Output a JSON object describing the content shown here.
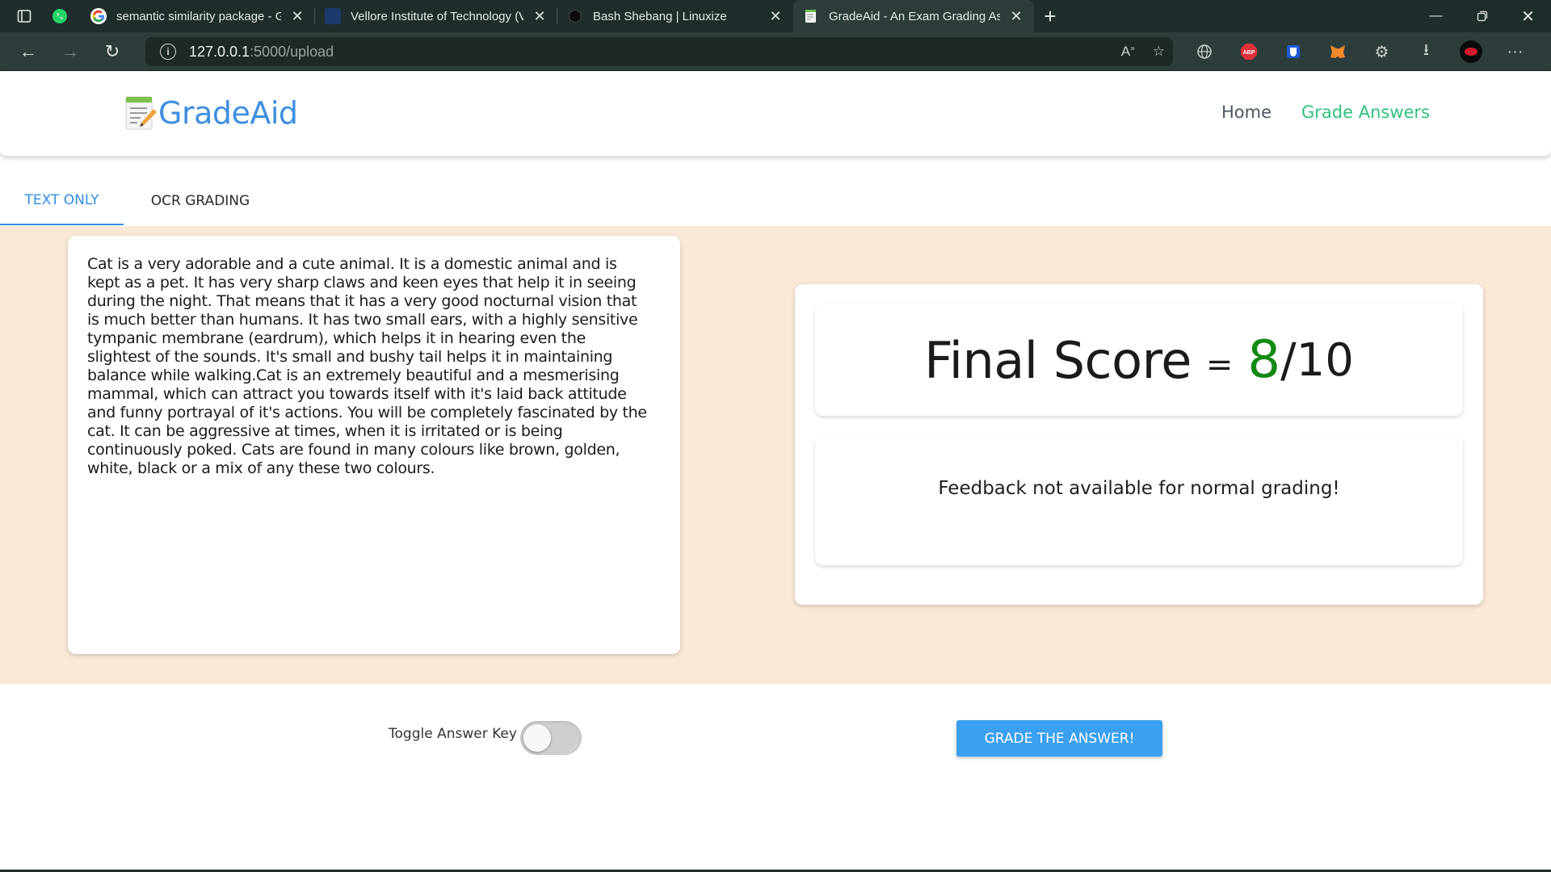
{
  "browser": {
    "tabs": [
      {
        "title": "semantic similarity package - Go",
        "favicon": "google-icon"
      },
      {
        "title": "Vellore Institute of Technology (V",
        "favicon": "vit-icon"
      },
      {
        "title": "Bash Shebang | Linuxize",
        "favicon": "linuxize-icon"
      },
      {
        "title": "GradeAid - An Exam Grading Ass",
        "favicon": "gradeaid-icon",
        "active": true
      }
    ],
    "url_host": "127.0.0.1",
    "url_rest": ":5000/upload"
  },
  "site": {
    "logo_text": "GradeAid",
    "nav": {
      "home": "Home",
      "grade": "Grade Answers"
    },
    "colors": {
      "brand": "#3f8fe0",
      "nav_active": "#2ec27e",
      "panel_bg": "#fae9d7",
      "score": "#138a13",
      "button": "#3ba0f0"
    }
  },
  "tabs": {
    "text_only": "TEXT ONLY",
    "ocr": "OCR GRADING"
  },
  "answer": {
    "text": "Cat is a very adorable and a cute animal. It is a domestic animal and is kept as a pet. It has very sharp claws and keen eyes that help it in seeing during the night. That means that it has a very good nocturnal vision that is much better than humans. It has two small ears, with a highly sensitive tympanic membrane (eardrum), which helps it in hearing even the slightest of the sounds. It's small and bushy tail helps it in maintaining balance while walking.Cat is an extremely beautiful and a mesmerising mammal, which can attract you towards itself with it's laid back attitude and funny portrayal of it's actions. You will be completely fascinated by the cat. It can be aggressive at times, when it is irritated or is being continuously poked. Cats are found in many colours like brown, golden, white, black or a mix of any these two colours."
  },
  "result": {
    "label": "Final Score",
    "eq": "=",
    "score": "8",
    "slash": "/",
    "max": "10",
    "feedback": "Feedback not available for normal grading!"
  },
  "controls": {
    "toggle_label": "Toggle Answer Key",
    "toggle_on": false,
    "grade_button": "GRADE THE ANSWER!"
  }
}
